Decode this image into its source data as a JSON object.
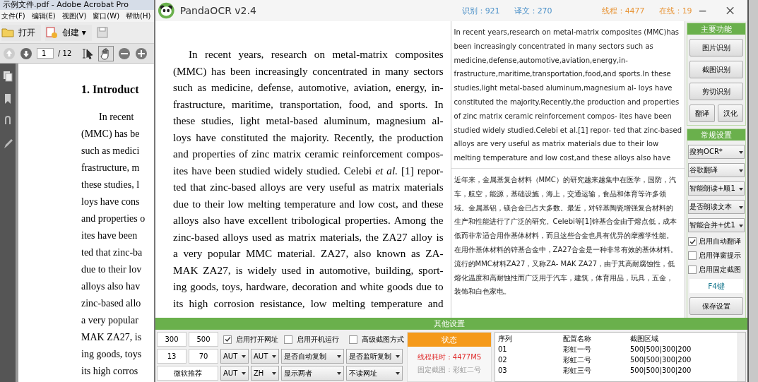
{
  "acrobat": {
    "title": "示例文件.pdf - Adobe Acrobat Pro",
    "menu": [
      "文件(F)",
      "编辑(E)",
      "视图(V)",
      "窗口(W)",
      "帮助(H)"
    ],
    "toolbar": {
      "open": "打开",
      "create": "创建 ▾"
    },
    "page": {
      "value": "1",
      "total": "/ 12"
    },
    "document": {
      "heading": "1. Introduct",
      "lines": [
        "In recent",
        "(MMC) has be",
        "such as medici",
        "frastructure, m",
        "these studies, l",
        "loys have cons",
        "and properties o",
        "ites have been",
        "ted that zinc-ba",
        "due to their lov",
        "alloys also hav",
        "zinc-based allo",
        "a very popular",
        "MAK ZA27, is",
        "ing goods, toys",
        "its high corros"
      ]
    }
  },
  "panda": {
    "title": "PandaOCR v2.4",
    "stats": [
      {
        "text": "识别：921",
        "color": "#4a90c8"
      },
      {
        "text": "译文：270",
        "color": "#4a90c8"
      },
      {
        "text": "线程：4477",
        "color": "#e8963a"
      },
      {
        "text": "在线：19",
        "color": "#e8963a"
      }
    ],
    "source_lines": [
      "In recent years, research on metal-matrix composites",
      "(MMC) has been increasingly concentrated in many sectors",
      "such as medicine, defense, automotive, aviation, energy, in-",
      "frastructure, maritime, transportation, food, and sports. In",
      "these studies, light metal-based aluminum, magnesium al-",
      "loys have constituted the majority. Recently, the production",
      "and properties of zinc matrix ceramic reinforcement compos-",
      "ites have been studied widely studied. Celebi *et al.* [1] repor-",
      "ted that zinc-based alloys are very useful as matrix materials",
      "due to their low melting temperature and low cost, and these",
      "alloys also have excellent tribological properties. Among the",
      "zinc-based alloys used as matrix materials, the ZA27 alloy is",
      "a very popular MMC material. ZA27, also known as ZA-",
      "MAK ZA27, is widely used in automotive, building, sport-",
      "ing goods, toys, hardware, decoration and white goods due to",
      "its high corrosion resistance, low melting temperature and"
    ],
    "ocr_lines": [
      "In recent years,research on metal-matrix composites (MMC)has",
      "been increasingly concentrated in many sectors such as",
      "medicine,defense,automotive,aviation,energy,in-",
      "frastructure,maritime,transportation,food,and sports.In these",
      "studies,light metal-based aluminum,magnesium al- loys have",
      "constituted the majority.Recently,the production and properties",
      "of zinc matrix ceramic reinforcement compos- ites have been",
      "studied widely studied.Celebi et al.[1] repor- ted that zinc-based",
      "alloys are very useful as matrix materials due to their low",
      "melting temperature and low cost,and these alloys also have"
    ],
    "translation_lines": [
      "近年来，金属基复合材料（MMC）的研究越来越集中在医学，国防，汽",
      "车，航空，能源，基础设施，海上，交通运输，食品和体育等许多领",
      "域。金属基铝，镁合金已占大多数。最近，对锌基陶瓷增强复合材料的",
      "生产和性能进行了广泛的研究。Celebi等[1]锌基合金由于熔点低，成本",
      "低而非常适合用作基体材料，而且这些合金也具有优异的摩擦学性能。",
      "在用作基体材料的锌基合金中，ZA27合金是一种非常有效的基体材料。",
      "流行的MMC材料ZA27，又称ZA- MAK ZA27，由于其高耐腐蚀性，低",
      "熔化温度和高耐蚀性而广泛用于汽车，建筑，体育用品，玩具，五金，",
      "装饰和白色家电。"
    ],
    "main_panel": {
      "title": "主要功能",
      "buttons": [
        "图片识别",
        "截图识别",
        "剪切识别"
      ],
      "small_buttons": [
        "翻译",
        "汉化"
      ]
    },
    "settings_panel": {
      "title": "常规设置",
      "selects": [
        "搜狗OCR*",
        "谷歌翻译",
        "智能朗读+顺1",
        "是否朗读文本",
        "智能合并+优1"
      ],
      "checkboxes": [
        {
          "label": "启用自动翻译",
          "checked": true
        },
        {
          "label": "启用弹窗提示",
          "checked": false
        },
        {
          "label": "启用固定截图",
          "checked": false
        }
      ],
      "hotkey": "F4键",
      "save": "保存设置"
    },
    "other_settings": {
      "title": "其他设置",
      "groups": [
        {
          "items": [
            {
              "kind": "input",
              "text": "300"
            },
            {
              "kind": "input",
              "text": "500"
            },
            {
              "kind": "checkbox",
              "text": "启用打开网址",
              "checked": true
            },
            {
              "kind": "checkbox",
              "text": "启用开机运行",
              "checked": false
            },
            {
              "kind": "checkbox",
              "text": "高级截图方式",
              "checked": false
            }
          ]
        },
        {
          "items": [
            {
              "kind": "input",
              "text": "13"
            },
            {
              "kind": "input",
              "text": "70"
            },
            {
              "kind": "select",
              "text": "AUT"
            },
            {
              "kind": "select",
              "text": "AUT"
            },
            {
              "kind": "select",
              "text": "是否自动复制"
            },
            {
              "kind": "select",
              "text": "是否监听复制"
            }
          ]
        },
        {
          "items": [
            {
              "kind": "button",
              "text": "微软推荐"
            },
            {
              "kind": "select",
              "text": "AUT"
            },
            {
              "kind": "select",
              "text": "ZH"
            },
            {
              "kind": "select",
              "text": "显示两者"
            },
            {
              "kind": "select",
              "text": "不读网址"
            }
          ]
        }
      ]
    },
    "status": {
      "title": "状态",
      "lines": [
        {
          "text": "线程耗时：4477MS",
          "kind": "alert"
        },
        {
          "text": "固定截图：彩虹二号",
          "kind": "info"
        }
      ]
    },
    "config_table": {
      "columns": [
        "序列",
        "配置名称",
        "截图区域"
      ],
      "rows": [
        [
          "01",
          "彩虹一号",
          "500|500|300|200"
        ],
        [
          "02",
          "彩虹二号",
          "500|500|300|200"
        ],
        [
          "03",
          "彩虹三号",
          "500|500|300|200"
        ]
      ]
    }
  }
}
